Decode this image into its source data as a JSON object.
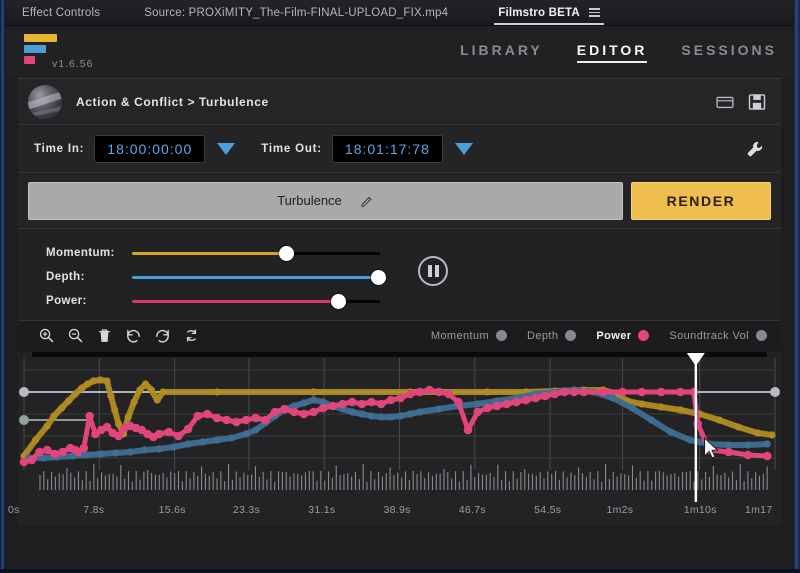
{
  "host_bar": {
    "tabs": [
      {
        "label": "Effect Controls",
        "active": false
      },
      {
        "label": "Source: PROXiMITY_The-Film-FINAL-UPLOAD_FIX.mp4",
        "active": false
      },
      {
        "label": "Filmstro BETA",
        "active": true
      }
    ],
    "menu_icon": "hamburger-menu-icon"
  },
  "brand": {
    "logo_icon": "filmstro-logo",
    "logo_colors": [
      "#e8b633",
      "#4a9fd8",
      "#e0457b"
    ],
    "version": "v1.6.56"
  },
  "main_nav": [
    {
      "label": "LIBRARY",
      "active": false
    },
    {
      "label": "EDITOR",
      "active": true
    },
    {
      "label": "SESSIONS",
      "active": false
    }
  ],
  "breadcrumb": {
    "thumbnail_icon": "album-artwork-thumbnail",
    "text": "Action & Conflict > Turbulence",
    "actions": [
      {
        "icon": "open-folder-icon",
        "name": "open-project-button"
      },
      {
        "icon": "save-floppy-icon",
        "name": "save-project-button"
      }
    ]
  },
  "time_controls": {
    "in_label": "Time In:",
    "in_value": "18:00:00:00",
    "out_label": "Time Out:",
    "out_value": "18:01:17:78",
    "dropdown_icon": "triangle-down-icon",
    "dropdown_color": "#4f9fdb",
    "settings_icon": "wrench-icon"
  },
  "title_row": {
    "name": "Turbulence",
    "edit_icon": "pencil-edit-icon",
    "render_label": "RENDER",
    "render_color": "#f0be4e"
  },
  "sliders": [
    {
      "label": "Momentum:",
      "color": "#d9a521",
      "value": 62
    },
    {
      "label": "Depth:",
      "color": "#4a9fd8",
      "value": 99
    },
    {
      "label": "Power:",
      "color": "#d8356f",
      "value": 83
    }
  ],
  "transport": {
    "icon": "pause-icon",
    "name": "pause-button"
  },
  "toolbar": [
    {
      "icon": "zoom-in-icon",
      "name": "zoom-in-button"
    },
    {
      "icon": "zoom-out-icon",
      "name": "zoom-out-button"
    },
    {
      "icon": "trash-icon",
      "name": "delete-button"
    },
    {
      "icon": "undo-icon",
      "name": "undo-button"
    },
    {
      "icon": "redo-icon",
      "name": "redo-button"
    },
    {
      "icon": "reset-icon",
      "name": "reset-button"
    }
  ],
  "legend": [
    {
      "label": "Momentum",
      "color": "#888890",
      "active": false
    },
    {
      "label": "Depth",
      "color": "#888890",
      "active": false
    },
    {
      "label": "Power",
      "color": "#e0457b",
      "active": true
    },
    {
      "label": "Soundtrack Vol",
      "color": "#888890",
      "active": false
    }
  ],
  "chart_data": {
    "type": "line",
    "title": "Turbulence automation curves",
    "xlabel": "",
    "ylabel": "",
    "grid": true,
    "xlim": [
      0,
      77.8
    ],
    "ylim": [
      0,
      100
    ],
    "legend_position": "top-right",
    "tick_labels": [
      "0s",
      "7.8s",
      "15.6s",
      "23.3s",
      "31.1s",
      "38.9s",
      "46.7s",
      "54.5s",
      "1m2s",
      "1m10s",
      "1m17"
    ],
    "tick_values": [
      0,
      7.8,
      15.6,
      23.3,
      31.1,
      38.9,
      46.7,
      54.5,
      62,
      70,
      77.8
    ],
    "playhead": {
      "time_s": 69.6,
      "color": "#ffffff",
      "marker": "triangle-down"
    },
    "cursor": {
      "x_s": 70.5,
      "y": 26,
      "icon": "mouse-pointer"
    },
    "series": [
      {
        "name": "Momentum",
        "color": "#b08c20",
        "x": [
          0,
          1.2,
          2.4,
          3.1,
          3.9,
          4.6,
          5.3,
          6.0,
          6.6,
          7.2,
          7.9,
          8.6,
          9.0,
          9.4,
          9.8,
          10.3,
          10.8,
          11.4,
          12.0,
          12.6,
          13.2,
          13.8,
          14.4,
          20,
          30,
          40,
          48,
          52,
          55,
          58,
          60,
          61.5,
          62.5,
          64,
          66,
          68,
          70,
          72,
          74,
          76,
          77.5
        ],
        "y": [
          8,
          24,
          38,
          48,
          56,
          63,
          70,
          76,
          80,
          83,
          84,
          83,
          68,
          54,
          40,
          30,
          47,
          62,
          74,
          80,
          74,
          64,
          72,
          72,
          72,
          72,
          72,
          72,
          73,
          74,
          74,
          70,
          63,
          60,
          57,
          54,
          50,
          44,
          37,
          31,
          29
        ]
      },
      {
        "name": "Depth",
        "color": "#3f6e94",
        "x": [
          0.5,
          2,
          3.5,
          5,
          6.5,
          8,
          9.5,
          11,
          12.5,
          14,
          15.5,
          17,
          18.5,
          20,
          21.5,
          23,
          24,
          25,
          26,
          27,
          28,
          29,
          30,
          31,
          32,
          33,
          34,
          35,
          36,
          37,
          38,
          39,
          40,
          41,
          43,
          45,
          47,
          49,
          51,
          53,
          55,
          57,
          59,
          61,
          63,
          65,
          67,
          69,
          71,
          73,
          75,
          77
        ],
        "y": [
          6,
          6,
          7,
          8,
          9,
          10,
          11,
          12,
          14,
          15,
          17,
          20,
          22,
          24,
          26,
          30,
          34,
          41,
          48,
          54,
          58,
          61,
          64,
          62,
          58,
          55,
          52,
          50,
          48,
          47,
          47,
          48,
          50,
          52,
          55,
          58,
          60,
          63,
          66,
          70,
          72,
          74,
          72,
          66,
          56,
          44,
          32,
          24,
          20,
          19,
          19,
          20
        ]
      },
      {
        "name": "Power",
        "color": "#e0457b",
        "x": [
          0,
          0.8,
          1.6,
          2.4,
          3.2,
          4.0,
          4.8,
          5.3,
          5.6,
          6.2,
          6.8,
          7.4,
          8.0,
          8.6,
          9.2,
          9.8,
          10.4,
          11.0,
          11.6,
          12.2,
          12.8,
          13.4,
          14.0,
          15.0,
          16.0,
          17.0,
          18.0,
          19.0,
          20.0,
          21.0,
          22.0,
          23.0,
          24.0,
          25.0,
          26.0,
          27.0,
          28.0,
          29.0,
          30.0,
          31.0,
          32.0,
          33.0,
          34.0,
          35.0,
          36.0,
          37.0,
          38.0,
          39.0,
          40.0,
          41.0,
          42.0,
          43.0,
          44.0,
          45.0,
          46.0,
          47.0,
          48.0,
          49.0,
          50.0,
          51.0,
          52.0,
          53.0,
          54.0,
          55.0,
          56.0,
          57.0,
          58.0,
          60.0,
          62.0,
          64.0,
          66.0,
          68.0,
          69.4,
          69.8,
          71.0,
          73.0,
          75.0,
          77.0
        ],
        "y": [
          2,
          4,
          12,
          14,
          10,
          12,
          16,
          14,
          12,
          16,
          48,
          30,
          34,
          37,
          31,
          28,
          36,
          38,
          36,
          34,
          30,
          27,
          30,
          32,
          28,
          35,
          48,
          50,
          46,
          44,
          42,
          44,
          46,
          44,
          52,
          55,
          52,
          50,
          52,
          56,
          58,
          60,
          62,
          60,
          62,
          60,
          64,
          66,
          70,
          72,
          74,
          72,
          70,
          62,
          34,
          52,
          56,
          58,
          60,
          62,
          64,
          66,
          68,
          70,
          72,
          72,
          72,
          72,
          72,
          72,
          72,
          72,
          72,
          40,
          14,
          12,
          9,
          8
        ]
      },
      {
        "name": "Soundtrack Vol",
        "color": "#b9b9c0",
        "x": [
          0,
          77.8
        ],
        "y": [
          72,
          72
        ],
        "markers_at": [
          0,
          77.8
        ]
      },
      {
        "name": "Soundtrack Vol secondary",
        "color": "#93a29a",
        "x": [
          0,
          6.5
        ],
        "y": [
          44,
          44
        ],
        "markers_at": [
          0
        ]
      }
    ]
  },
  "colors": {
    "accent_yellow": "#f0be4e",
    "accent_blue": "#4a9fd8",
    "accent_pink": "#e0457b",
    "panel_bg": "#1e1e20",
    "graph_bg": "#232325"
  }
}
